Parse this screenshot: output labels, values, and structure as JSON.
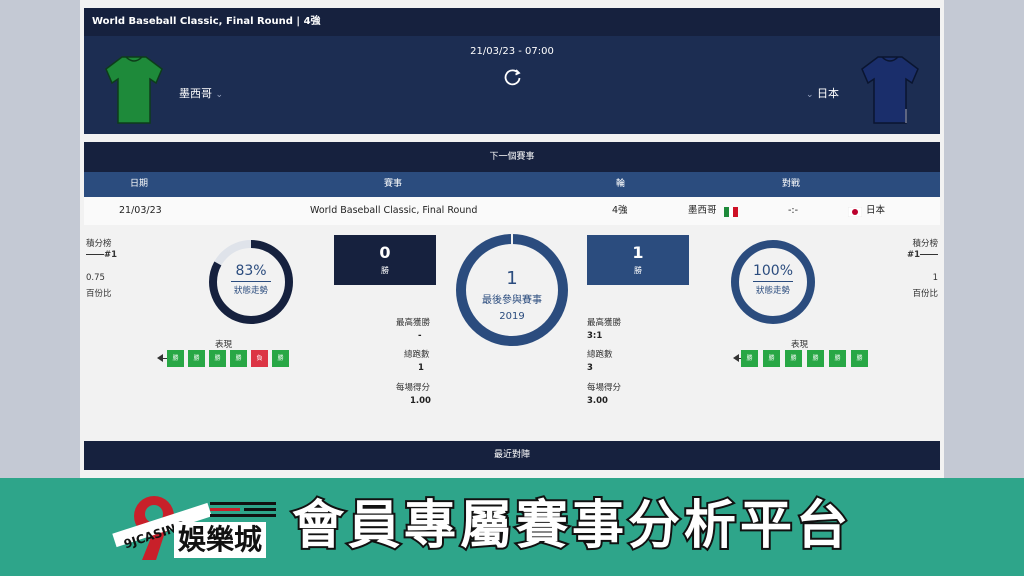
{
  "header": {
    "title": "World Baseball Classic, Final Round | 4強",
    "datetime": "21/03/23 - 07:00",
    "home": {
      "name": "墨西哥",
      "shirt_color": "#1e8a3a"
    },
    "away": {
      "name": "日本",
      "shirt_color": "#1a2e6b"
    },
    "icons": {
      "refresh": "refresh-icon",
      "chevron": "chevron-down-icon"
    }
  },
  "next_event": {
    "title": "下一個賽事",
    "columns": [
      "日期",
      "賽事",
      "輪",
      "對戰"
    ],
    "row": {
      "date": "21/03/23",
      "event": "World Baseball Classic, Final Round",
      "round": "4強",
      "home": "墨西哥",
      "score": "-:-",
      "away": "日本"
    }
  },
  "stats": {
    "home": {
      "standing_label": "積分榜",
      "rank": "#1",
      "pct_value": "0.75",
      "pct_label": "百份比",
      "form_percent": "83%",
      "form_fraction": 0.83,
      "form_label": "狀態走勢",
      "wins": "0",
      "wins_label": "勝",
      "biggest_win_label": "最高獲勝",
      "biggest_win": "-",
      "total_runs_label": "總跑數",
      "total_runs": "1",
      "per_game_label": "每場得分",
      "per_game": "1.00",
      "performance_label": "表現",
      "form": [
        "勝",
        "勝",
        "勝",
        "勝",
        "負",
        "勝"
      ]
    },
    "center": {
      "count": "1",
      "label": "最後參與賽事",
      "year": "2019"
    },
    "away": {
      "standing_label": "積分榜",
      "rank": "#1",
      "pct_value": "1",
      "pct_label": "百份比",
      "form_percent": "100%",
      "form_fraction": 1.0,
      "form_label": "狀態走勢",
      "wins": "1",
      "wins_label": "勝",
      "biggest_win_label": "最高獲勝",
      "biggest_win": "3:1",
      "total_runs_label": "總跑數",
      "total_runs": "3",
      "per_game_label": "每場得分",
      "per_game": "3.00",
      "performance_label": "表現",
      "form": [
        "勝",
        "勝",
        "勝",
        "勝",
        "勝",
        "勝"
      ]
    }
  },
  "recent": {
    "title": "最近對陣"
  },
  "banner": {
    "logo_text": "9JCASINO",
    "logo_sub": "娛樂城",
    "text": "會員專屬賽事分析平台"
  },
  "colors": {
    "navy": "#16213e",
    "header_blue": "#1c2d52",
    "column_blue": "#2b4c7e",
    "win": "#28a745",
    "loss": "#dc3545",
    "banner": "#2ea58a"
  }
}
